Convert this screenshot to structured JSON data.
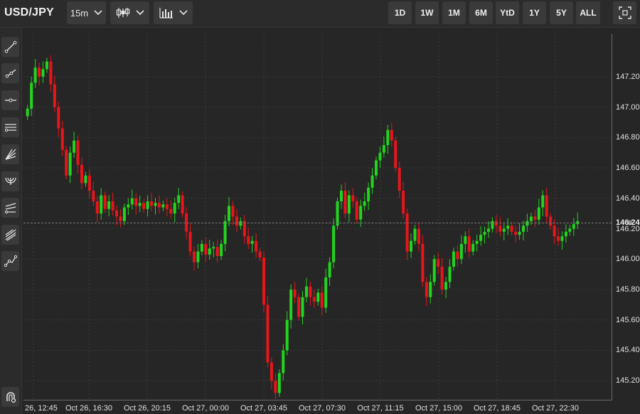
{
  "header": {
    "symbol": "USD/JPY",
    "interval": "15m",
    "chart_type_icon": "candlestick-icon",
    "indicator_icon": "bar-chart-icon",
    "ranges": [
      "1D",
      "1W",
      "1M",
      "6M",
      "YtD",
      "1Y",
      "5Y",
      "ALL"
    ],
    "fullscreen_icon": "fullscreen-icon"
  },
  "sidebar": {
    "tools": [
      "trend-line-icon",
      "ray-icon",
      "horizontal-line-icon",
      "parallel-channel-icon",
      "fan-icon",
      "arc-icon",
      "fib-retracement-icon",
      "pitchfork-icon",
      "path-icon"
    ],
    "bottom_tool": "magnet-icon"
  },
  "chart_data": {
    "type": "candlestick",
    "title": "",
    "xlabel": "",
    "ylabel": "",
    "ylim": [
      145.07,
      147.48
    ],
    "current_price": "146.24",
    "y_ticks": [
      "147.20",
      "147.00",
      "146.80",
      "146.60",
      "146.40",
      "146.20",
      "146.00",
      "145.80",
      "145.60",
      "145.40",
      "145.20"
    ],
    "x_ticks": [
      "26, 12:45",
      "Oct 26, 16:30",
      "Oct 26, 20:15",
      "Oct 27, 00:00",
      "Oct 27, 03:45",
      "Oct 27, 07:30",
      "Oct 27, 11:15",
      "Oct 27, 15:00",
      "Oct 27, 18:45",
      "Oct 27, 22:30"
    ],
    "up_color": "#22d41e",
    "down_color": "#e8151b",
    "closes": [
      146.99,
      147.16,
      147.26,
      147.2,
      147.25,
      147.3,
      147.15,
      147.0,
      146.86,
      146.72,
      146.55,
      146.7,
      146.78,
      146.62,
      146.5,
      146.55,
      146.45,
      146.38,
      146.3,
      146.42,
      146.33,
      146.38,
      146.32,
      146.28,
      146.25,
      146.34,
      146.36,
      146.4,
      146.35,
      146.37,
      146.33,
      146.38,
      146.35,
      146.37,
      146.34,
      146.36,
      146.33,
      146.3,
      146.37,
      146.42,
      146.3,
      146.18,
      146.05,
      145.98,
      146.05,
      146.1,
      146.03,
      146.07,
      146.08,
      146.02,
      146.1,
      146.25,
      146.35,
      146.28,
      146.22,
      146.25,
      146.15,
      146.1,
      146.12,
      146.05,
      146.01,
      145.7,
      145.32,
      145.2,
      145.12,
      145.25,
      145.4,
      145.6,
      145.8,
      145.75,
      145.62,
      145.75,
      145.82,
      145.75,
      145.72,
      145.78,
      145.68,
      145.88,
      145.98,
      146.22,
      146.38,
      146.45,
      146.3,
      146.42,
      146.38,
      146.26,
      146.35,
      146.38,
      146.47,
      146.55,
      146.65,
      146.7,
      146.75,
      146.85,
      146.78,
      146.6,
      146.45,
      146.3,
      146.05,
      146.12,
      146.2,
      146.1,
      145.85,
      145.75,
      145.85,
      146.0,
      145.95,
      145.8,
      145.85,
      145.95,
      146.05,
      146.0,
      146.1,
      146.15,
      146.05,
      146.1,
      146.12,
      146.16,
      146.18,
      146.2,
      146.25,
      146.22,
      146.18,
      146.2,
      146.22,
      146.18,
      146.16,
      146.18,
      146.22,
      146.25,
      146.28,
      146.26,
      146.34,
      146.42,
      146.28,
      146.22,
      146.15,
      146.12,
      146.15,
      146.18,
      146.2,
      146.23,
      146.25
    ]
  }
}
